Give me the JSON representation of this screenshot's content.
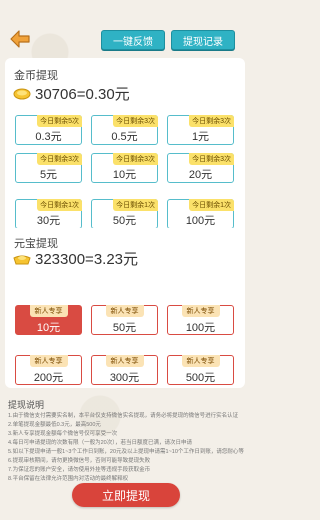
{
  "header": {
    "feedback_label": "一键反馈",
    "records_label": "提现记录"
  },
  "gold": {
    "title": "金币提现",
    "balance": "30706=0.30元",
    "options": [
      {
        "tag": "今日剩余5次",
        "amount": "0.3元"
      },
      {
        "tag": "今日剩余3次",
        "amount": "0.5元"
      },
      {
        "tag": "今日剩余3次",
        "amount": "1元"
      },
      {
        "tag": "今日剩余3次",
        "amount": "5元"
      },
      {
        "tag": "今日剩余3次",
        "amount": "10元"
      },
      {
        "tag": "今日剩余3次",
        "amount": "20元"
      },
      {
        "tag": "今日剩余1次",
        "amount": "30元"
      },
      {
        "tag": "今日剩余1次",
        "amount": "50元"
      },
      {
        "tag": "今日剩余1次",
        "amount": "100元"
      }
    ]
  },
  "yuanbao": {
    "title": "元宝提现",
    "balance": "323300=3.23元",
    "options": [
      {
        "tag": "新人专享",
        "amount": "10元"
      },
      {
        "tag": "新人专享",
        "amount": "50元"
      },
      {
        "tag": "新人专享",
        "amount": "100元"
      },
      {
        "tag": "新人专享",
        "amount": "200元"
      },
      {
        "tag": "新人专享",
        "amount": "300元"
      },
      {
        "tag": "新人专享",
        "amount": "500元"
      }
    ],
    "selected_index": 0
  },
  "instructions": {
    "title": "提现说明",
    "lines": [
      "1.由于微信支付需要实名制，本平台仅支持微信实名提现，请务必将提现的微信号进行实名认证",
      "2.单笔提现金额最低0.3元，最高500元",
      "3.新人专享提现金额每个微信号仅可享受一次",
      "4.每日可申请提现的次数有限（一般为20次），若当日额度已满，请次日申请",
      "5.如以下提现申请一般1~3个工作日到账，20元及以上提现申请需1~10个工作日到账，请您耐心等候",
      "6.提现审核期间，请勿更换微信号，否则可能导致提现失败",
      "7.为保证您的账户安全，请勿使用外挂等违规手段获取金币",
      "8.平台保留在法律允许范围内对活动的最终解释权"
    ]
  },
  "withdraw_label": "立即提现",
  "colors": {
    "teal": "#2fb2c4",
    "tag_yellow": "#fbe16a",
    "red": "#d94b42"
  }
}
